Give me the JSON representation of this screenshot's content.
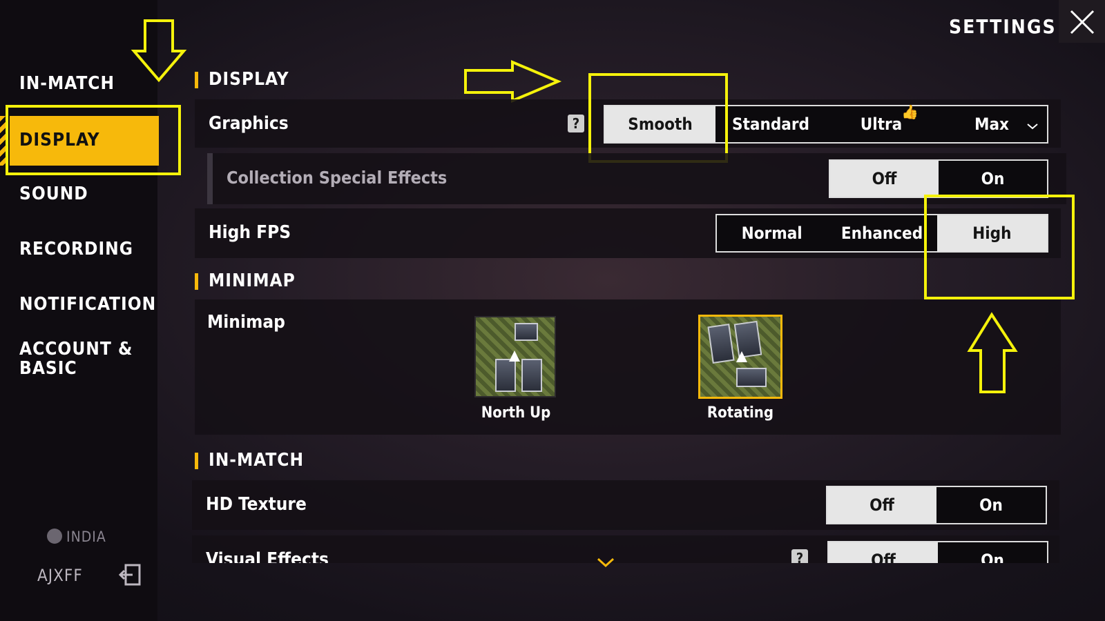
{
  "header": {
    "title": "SETTINGS"
  },
  "sidebar": {
    "items": [
      {
        "label": "IN-MATCH"
      },
      {
        "label": "DISPLAY"
      },
      {
        "label": "SOUND"
      },
      {
        "label": "RECORDING"
      },
      {
        "label": "NOTIFICATION"
      },
      {
        "label": "ACCOUNT &\nBASIC"
      }
    ],
    "active": "DISPLAY",
    "region": "INDIA",
    "username": "AJXFF"
  },
  "display": {
    "section_title": "DISPLAY",
    "graphics": {
      "label": "Graphics",
      "options": [
        "Smooth",
        "Standard",
        "Ultra",
        "Max"
      ],
      "selected": "Smooth"
    },
    "collection_effects": {
      "label": "Collection Special Effects",
      "options": [
        "Off",
        "On"
      ],
      "selected": "Off"
    },
    "high_fps": {
      "label": "High FPS",
      "options": [
        "Normal",
        "Enhanced",
        "High"
      ],
      "selected": "High"
    }
  },
  "minimap": {
    "section_title": "MINIMAP",
    "label": "Minimap",
    "options": [
      {
        "label": "North Up",
        "selected": false
      },
      {
        "label": "Rotating",
        "selected": true
      }
    ]
  },
  "in_match": {
    "section_title": "IN-MATCH",
    "hd_texture": {
      "label": "HD Texture",
      "options": [
        "Off",
        "On"
      ],
      "selected": "Off"
    },
    "visual_effects": {
      "label": "Visual Effects",
      "options": [
        "Off",
        "On"
      ],
      "selected": "Off"
    }
  },
  "colors": {
    "accent": "#f7b90b",
    "annotation": "#f5f20b",
    "selected_option": "#e6e6e6"
  },
  "icons": [
    "close-icon",
    "help-icon",
    "thumbs-up-icon",
    "chevron-down-icon",
    "globe-icon",
    "logout-icon"
  ]
}
